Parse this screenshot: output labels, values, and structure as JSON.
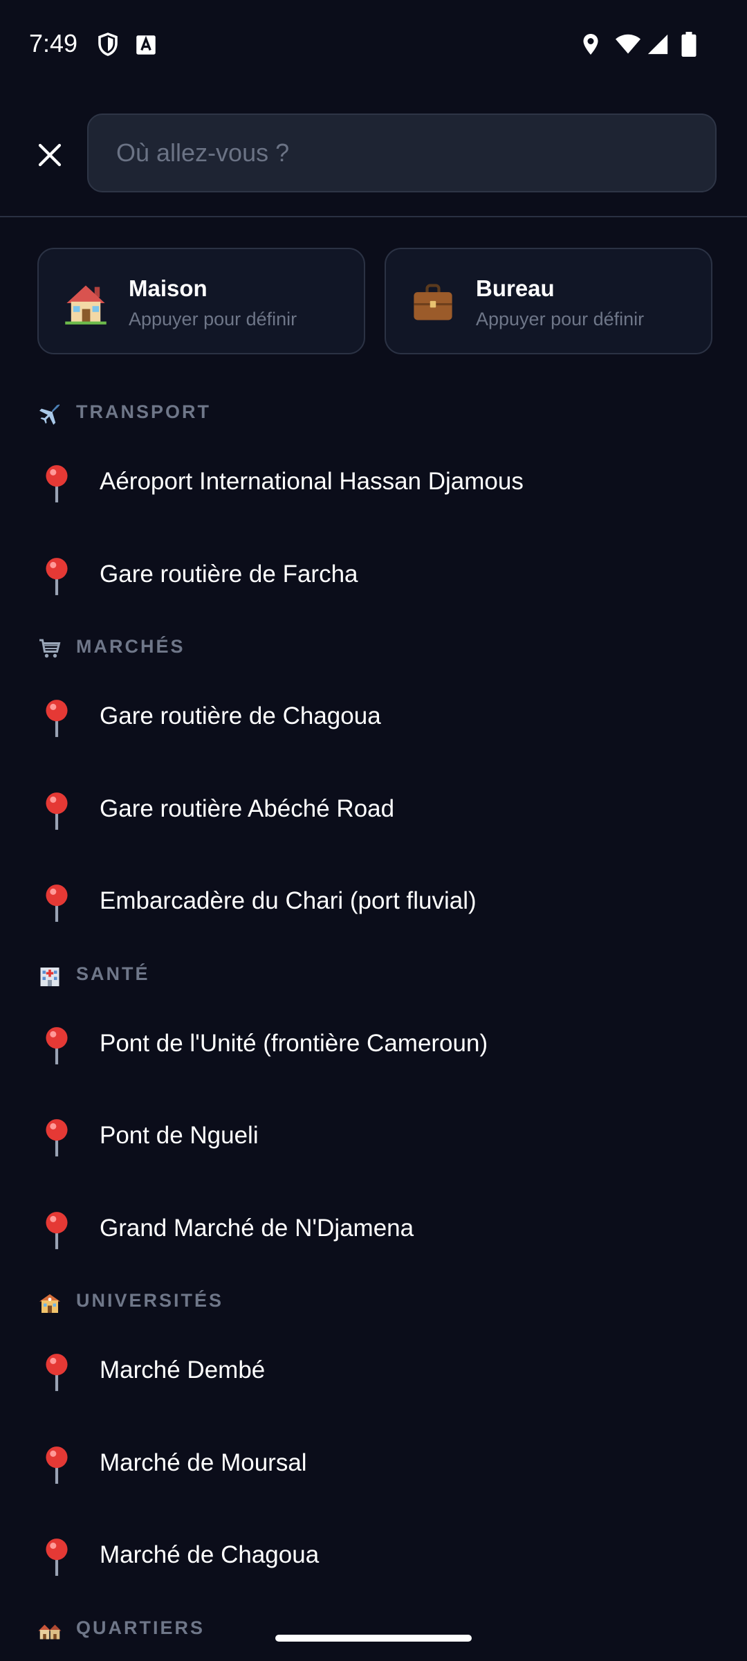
{
  "status_bar": {
    "time": "7:49"
  },
  "search": {
    "placeholder": "Où allez-vous ?",
    "value": ""
  },
  "shortcuts": [
    {
      "icon": "house-icon",
      "title": "Maison",
      "subtitle": "Appuyer pour définir"
    },
    {
      "icon": "briefcase-icon",
      "title": "Bureau",
      "subtitle": "Appuyer pour définir"
    }
  ],
  "sections": [
    {
      "icon": "airplane-icon",
      "label": "TRANSPORT",
      "items": [
        "Aéroport International Hassan Djamous",
        "Gare routière de Farcha"
      ]
    },
    {
      "icon": "shopping-cart-icon",
      "label": "MARCHÉS",
      "items": [
        "Gare routière de Chagoua",
        "Gare routière Abéché Road",
        "Embarcadère du Chari (port fluvial)"
      ]
    },
    {
      "icon": "hospital-icon",
      "label": "SANTÉ",
      "items": [
        "Pont de l'Unité (frontière Cameroun)",
        "Pont de Ngueli",
        "Grand Marché de N'Djamena"
      ]
    },
    {
      "icon": "school-icon",
      "label": "UNIVERSITÉS",
      "items": [
        "Marché Dembé",
        "Marché de Moursal",
        "Marché de Chagoua"
      ]
    },
    {
      "icon": "houses-icon",
      "label": "QUARTIERS",
      "items": []
    }
  ],
  "colors": {
    "background": "#0b0d1a",
    "search_bg": "#1e2433",
    "card_border": "#2b3244",
    "section_label": "#6f7789",
    "pin_red": "#e53935"
  }
}
